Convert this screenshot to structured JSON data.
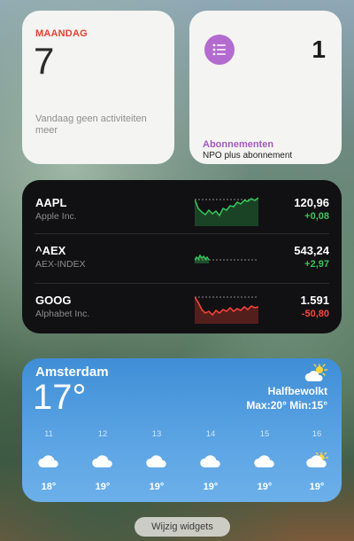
{
  "calendar": {
    "day": "MAANDAG",
    "date": "7",
    "note": "Vandaag geen activiteiten meer"
  },
  "reminders": {
    "icon": "list-icon",
    "count": "1",
    "title": "Abonnementen",
    "item": "NPO plus abonnement"
  },
  "stocks": [
    {
      "symbol": "AAPL",
      "name": "Apple Inc.",
      "price": "120,96",
      "change": "+0,08",
      "color": "#34c759"
    },
    {
      "symbol": "^AEX",
      "name": "AEX-INDEX",
      "price": "543,24",
      "change": "+2,97",
      "color": "#34c759"
    },
    {
      "symbol": "GOOG",
      "name": "Alphabet Inc.",
      "price": "1.591",
      "change": "-50,80",
      "color": "#ff453a"
    }
  ],
  "weather": {
    "city": "Amsterdam",
    "temp": "17°",
    "condition": "Halfbewolkt",
    "range": "Max:20° Min:15°",
    "condition_icon": "partly-sunny-icon",
    "hourly": [
      {
        "hour": "11",
        "icon": "cloud-icon",
        "temp": "18°"
      },
      {
        "hour": "12",
        "icon": "cloud-icon",
        "temp": "19°"
      },
      {
        "hour": "13",
        "icon": "cloud-icon",
        "temp": "19°"
      },
      {
        "hour": "14",
        "icon": "cloud-icon",
        "temp": "19°"
      },
      {
        "hour": "15",
        "icon": "cloud-icon",
        "temp": "19°"
      },
      {
        "hour": "16",
        "icon": "partly-sunny-icon",
        "temp": "19°"
      }
    ]
  },
  "edit_button": "Wijzig widgets"
}
